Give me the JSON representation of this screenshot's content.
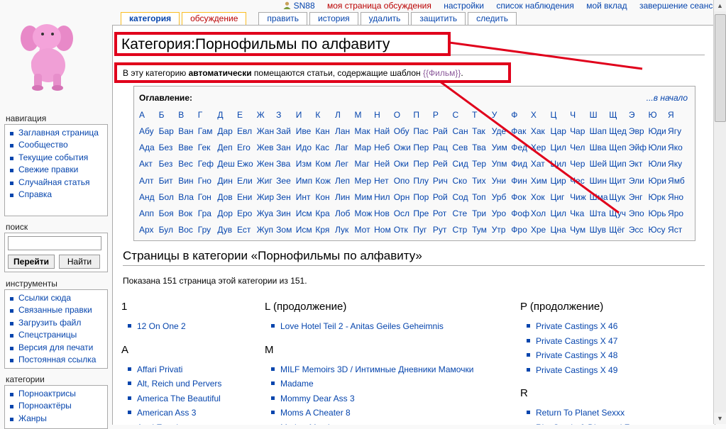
{
  "personal": {
    "username": "SN88",
    "talk": "моя страница обсуждения",
    "prefs": "настройки",
    "watchlist": "список наблюдения",
    "contribs": "мой вклад",
    "logout": "завершение сеанса"
  },
  "tabs": {
    "category": "категория",
    "discussion": "обсуждение",
    "edit": "править",
    "history": "история",
    "delete": "удалить",
    "protect": "защитить",
    "watch": "следить"
  },
  "sidebar": {
    "nav_title": "навигация",
    "nav": [
      "Заглавная страница",
      "Сообщество",
      "Текущие события",
      "Свежие правки",
      "Случайная статья",
      "Справка"
    ],
    "search_title": "поиск",
    "go": "Перейти",
    "find": "Найти",
    "tools_title": "инструменты",
    "tools": [
      "Ссылки сюда",
      "Связанные правки",
      "Загрузить файл",
      "Спецстраницы",
      "Версия для печати",
      "Постоянная ссылка"
    ],
    "cats_title": "категории",
    "cats": [
      "Порноактрисы",
      "Порноактёры",
      "Жанры"
    ]
  },
  "page": {
    "title": "Категория:Порнофильмы по алфавиту",
    "desc_a": "В эту категорию ",
    "desc_bold": "автоматически",
    "desc_b": " помещаются статьи, содержащие шаблон ",
    "desc_tpl": "{{Фильм}}",
    "desc_c": ".",
    "h2": "Страницы в категории «Порнофильмы по алфавиту»",
    "count": "Показана 151 страница этой категории из 151."
  },
  "toc": {
    "title": "Оглавление:",
    "to_start": "...в начало",
    "letters": [
      "А",
      "Б",
      "В",
      "Г",
      "Д",
      "Е",
      "Ж",
      "З",
      "И",
      "К",
      "Л",
      "М",
      "Н",
      "О",
      "П",
      "Р",
      "С",
      "Т",
      "У",
      "Ф",
      "Х",
      "Ц",
      "Ч",
      "Ш",
      "Щ",
      "Э",
      "Ю",
      "Я"
    ],
    "rows": [
      [
        "Абу",
        "Бар",
        "Ван",
        "Гам",
        "Дар",
        "Евл",
        "Жан",
        "Зай",
        "Иве",
        "Кан",
        "Лан",
        "Мак",
        "Най",
        "Обу",
        "Пас",
        "Рай",
        "Сан",
        "Так",
        "Уде",
        "Фак",
        "Хак",
        "Цар",
        "Чар",
        "Шап",
        "Щед",
        "Эвр",
        "Юди",
        "Ягу"
      ],
      [
        "Ада",
        "Без",
        "Вве",
        "Гек",
        "Деп",
        "Его",
        "Жев",
        "Зан",
        "Идо",
        "Кас",
        "Лаг",
        "Мар",
        "Неб",
        "Ожи",
        "Пер",
        "Рац",
        "Сев",
        "Тва",
        "Уим",
        "Фед",
        "Хер",
        "Цил",
        "Чел",
        "Шва",
        "Щеп",
        "Эйф",
        "Юли",
        "Яко"
      ],
      [
        "Акт",
        "Без",
        "Вес",
        "Геф",
        "Деш",
        "Ежо",
        "Жен",
        "Зва",
        "Изм",
        "Ком",
        "Лег",
        "Маг",
        "Ней",
        "Оки",
        "Пер",
        "Рей",
        "Сид",
        "Тер",
        "Упм",
        "Фид",
        "Хат",
        "Цил",
        "Чер",
        "Шей",
        "Щип",
        "Экт",
        "Юли",
        "Яку"
      ],
      [
        "Алт",
        "Бит",
        "Вин",
        "Гно",
        "Дин",
        "Ели",
        "Жиг",
        "Зее",
        "Имп",
        "Кож",
        "Леп",
        "Мер",
        "Нет",
        "Опо",
        "Плу",
        "Рич",
        "Ско",
        "Тих",
        "Уни",
        "Фин",
        "Хим",
        "Цир",
        "Чес",
        "Шин",
        "Щит",
        "Эли",
        "Юри",
        "Ямб"
      ],
      [
        "Анд",
        "Бол",
        "Вла",
        "Гон",
        "Дов",
        "Ени",
        "Жир",
        "Зен",
        "Инт",
        "Кон",
        "Лин",
        "Мим",
        "Нил",
        "Орн",
        "Пор",
        "Рой",
        "Сод",
        "Топ",
        "Урб",
        "Фок",
        "Хок",
        "Циг",
        "Чиж",
        "Шма",
        "Щук",
        "Энг",
        "Юрк",
        "Яно"
      ],
      [
        "Апп",
        "Боя",
        "Вок",
        "Гра",
        "Дор",
        "Еро",
        "Жуа",
        "Зин",
        "Исм",
        "Кра",
        "Лоб",
        "Мож",
        "Нов",
        "Осл",
        "Пре",
        "Рот",
        "Сте",
        "Три",
        "Уро",
        "Фоф",
        "Хол",
        "Цил",
        "Чка",
        "Шта",
        "Щуч",
        "Эпо",
        "Юрь",
        "Яро"
      ],
      [
        "Арх",
        "Бул",
        "Вос",
        "Гру",
        "Дув",
        "Ест",
        "Жуп",
        "Зом",
        "Исм",
        "Кря",
        "Лук",
        "Мот",
        "Ном",
        "Отк",
        "Пуг",
        "Рут",
        "Стр",
        "Тум",
        "Утр",
        "Фро",
        "Хре",
        "Цна",
        "Чум",
        "Шув",
        "Щёг",
        "Эсс",
        "Юсу",
        "Яст"
      ]
    ]
  },
  "columns": [
    [
      {
        "head": "1",
        "items": [
          "12 On One 2"
        ]
      },
      {
        "head": "A",
        "items": [
          "Affari Privati",
          "Alt, Reich und Pervers",
          "America The Beautiful",
          "American Ass 3",
          "Anal Emotion"
        ]
      }
    ],
    [
      {
        "head": "L (продолжение)",
        "items": [
          "Love Hotel Teil 2 - Anitas Geiles Geheimnis"
        ]
      },
      {
        "head": "M",
        "items": [
          "MILF Memoirs 3D / Интимные Дневники Мамочки",
          "Madame",
          "Mommy Dear Ass 3",
          "Moms A Cheater 8",
          "Mother May I"
        ]
      }
    ],
    [
      {
        "head": "P (продолжение)",
        "items": [
          "Private Castings X 46",
          "Private Castings X 47",
          "Private Castings X 48",
          "Private Castings X 49"
        ]
      },
      {
        "head": "R",
        "items": [
          "Return To Planet Sexxx",
          "Rita Steele & Diamond Foxxx"
        ]
      }
    ]
  ],
  "colors": {
    "link": "#0645ad",
    "redlink": "#ba0000",
    "annotation": "#e0001b",
    "tab_border": "#fabd23"
  }
}
